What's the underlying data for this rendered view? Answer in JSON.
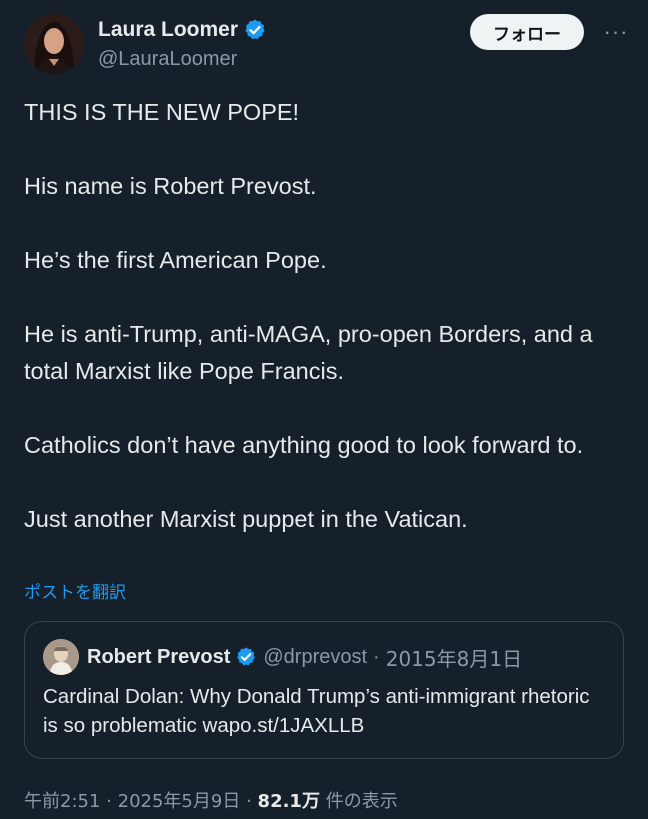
{
  "author": {
    "display_name": "Laura Loomer",
    "handle": "@LauraLoomer",
    "verified": true,
    "avatar_icon": "avatar-photo"
  },
  "actions": {
    "follow_label": "フォロー",
    "more_label": "···"
  },
  "post": {
    "paragraphs": [
      "THIS IS THE NEW POPE!",
      "His name is Robert Prevost.",
      "He’s the first American Pope.",
      "He is anti-Trump, anti-MAGA, pro-open Borders, and a total Marxist like Pope Francis.",
      "Catholics don’t have anything good to look forward to.",
      "Just another Marxist puppet in the Vatican."
    ],
    "translate_label": "ポストを翻訳"
  },
  "quote": {
    "display_name": "Robert Prevost",
    "handle": "@drprevost",
    "separator": "·",
    "date": "2015年8月1日",
    "text": "Cardinal Dolan: Why Donald Trump’s anti-immigrant rhetoric is so problematic ",
    "link": "wapo.st/1JAXLLB"
  },
  "meta": {
    "time": "午前2:51",
    "separator": "·",
    "date": "2025年5月9日",
    "views_count": "82.1万",
    "views_label": "件の表示"
  },
  "colors": {
    "background": "#15202b",
    "text": "#e7e9ea",
    "muted": "#8b98a5",
    "accent": "#1d9bf0",
    "border": "#38444d"
  }
}
